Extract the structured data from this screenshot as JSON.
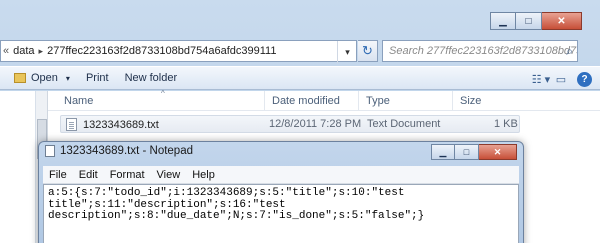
{
  "explorer": {
    "window_controls": {
      "minimize": "▁",
      "maximize": "□",
      "close": "✕"
    },
    "address": {
      "prefix_chevron": "«",
      "folder": "data",
      "separator": "▸",
      "current": "277ffec223163f2d8733108bd754a6afdc399111",
      "dropdown": "▾"
    },
    "refresh_icon": "↻",
    "search_placeholder": "Search 277ffec223163f2d8733108bd75...",
    "search_icon": "⌕",
    "toolbar": {
      "open_label": "Open",
      "open_dropdown": "▾",
      "print_label": "Print",
      "new_folder_label": "New folder",
      "view_icon": "☷ ▾",
      "pane_icon": "▭",
      "help_icon": "?"
    },
    "columns": {
      "name": "Name",
      "date_modified": "Date modified",
      "type": "Type",
      "size": "Size",
      "sort_caret": "^"
    },
    "files": [
      {
        "name": "1323343689.txt",
        "date_modified": "12/8/2011 7:28 PM",
        "type": "Text Document",
        "size": "1 KB"
      }
    ]
  },
  "notepad": {
    "title": "1323343689.txt - Notepad",
    "controls": {
      "minimize": "▁",
      "maximize": "□",
      "close": "✕"
    },
    "menu": [
      "File",
      "Edit",
      "Format",
      "View",
      "Help"
    ],
    "content": "a:5:{s:7:\"todo_id\";i:1323343689;s:5:\"title\";s:10:\"test\ntitle\";s:11:\"description\";s:16:\"test\ndescription\";s:8:\"due_date\";N;s:7:\"is_done\";s:5:\"false\";}"
  }
}
